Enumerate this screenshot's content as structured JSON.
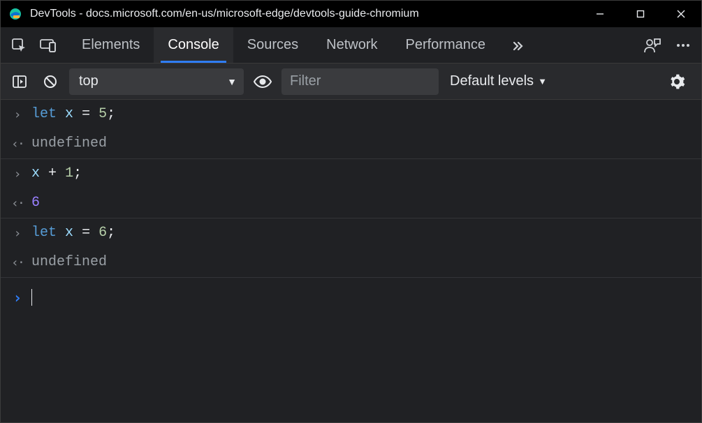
{
  "window": {
    "title": "DevTools - docs.microsoft.com/en-us/microsoft-edge/devtools-guide-chromium"
  },
  "tabs": {
    "items": [
      "Elements",
      "Console",
      "Sources",
      "Network",
      "Performance"
    ],
    "active_index": 1
  },
  "toolbar": {
    "context": "top",
    "filter_placeholder": "Filter",
    "filter_value": "",
    "levels_label": "Default levels"
  },
  "console_entries": [
    {
      "type": "input",
      "tokens": [
        [
          "kw",
          "let"
        ],
        [
          "sp",
          " "
        ],
        [
          "var",
          "x"
        ],
        [
          "sp",
          " "
        ],
        [
          "op",
          "="
        ],
        [
          "sp",
          " "
        ],
        [
          "num",
          "5"
        ],
        [
          "punc",
          ";"
        ]
      ]
    },
    {
      "type": "output",
      "result_kind": "undefined",
      "result_text": "undefined"
    },
    {
      "type": "input",
      "tokens": [
        [
          "var",
          "x"
        ],
        [
          "sp",
          " "
        ],
        [
          "op",
          "+"
        ],
        [
          "sp",
          " "
        ],
        [
          "num",
          "1"
        ],
        [
          "punc",
          ";"
        ]
      ]
    },
    {
      "type": "output",
      "result_kind": "number",
      "result_text": "6"
    },
    {
      "type": "input",
      "tokens": [
        [
          "kw",
          "let"
        ],
        [
          "sp",
          " "
        ],
        [
          "var",
          "x"
        ],
        [
          "sp",
          " "
        ],
        [
          "op",
          "="
        ],
        [
          "sp",
          " "
        ],
        [
          "num",
          "6"
        ],
        [
          "punc",
          ";"
        ]
      ]
    },
    {
      "type": "output",
      "result_kind": "undefined",
      "result_text": "undefined"
    }
  ],
  "glyphs": {
    "input_prompt": "›",
    "output_prompt": "‹·",
    "live_prompt": "›",
    "dropdown_caret": "▼"
  }
}
